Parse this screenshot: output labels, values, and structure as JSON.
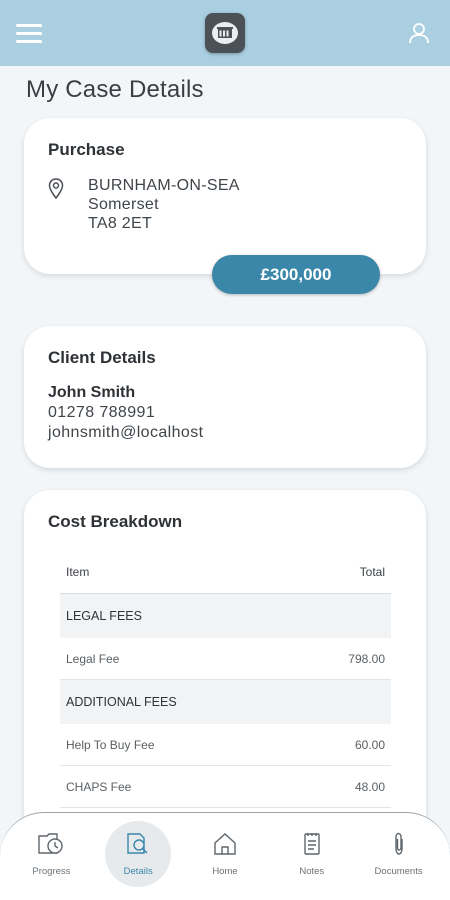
{
  "header": {
    "menu_icon": "hamburger-menu-icon",
    "logo_icon": "building-logo-icon",
    "account_icon": "user-icon"
  },
  "page": {
    "title": "My Case Details"
  },
  "purchase": {
    "title": "Purchase",
    "address": [
      "BURNHAM-ON-SEA",
      "Somerset",
      "TA8 2ET"
    ],
    "price": "£300,000",
    "accent": "#3a87aa"
  },
  "client": {
    "title": "Client Details",
    "name": "John Smith",
    "phone": "01278 788991",
    "email": "johnsmith@localhost"
  },
  "cost": {
    "title": "Cost Breakdown",
    "columns": {
      "item": "Item",
      "total": "Total"
    },
    "sections": [
      {
        "label": "LEGAL FEES",
        "rows": [
          {
            "item": "Legal Fee",
            "total": "798.00"
          }
        ]
      },
      {
        "label": "ADDITIONAL FEES",
        "rows": [
          {
            "item": "Help To Buy Fee",
            "total": "60.00"
          },
          {
            "item": "CHAPS Fee",
            "total": "48.00"
          }
        ]
      }
    ]
  },
  "nav": {
    "items": [
      {
        "label": "Progress",
        "icon": "progress-clock-icon"
      },
      {
        "label": "Details",
        "icon": "details-search-icon",
        "active": true
      },
      {
        "label": "Home",
        "icon": "home-icon"
      },
      {
        "label": "Notes",
        "icon": "notes-icon"
      },
      {
        "label": "Documents",
        "icon": "paperclip-icon"
      }
    ]
  },
  "colors": {
    "header_bg": "#a9cfe0",
    "accent": "#3a87aa",
    "background": "#f3f6f8"
  }
}
